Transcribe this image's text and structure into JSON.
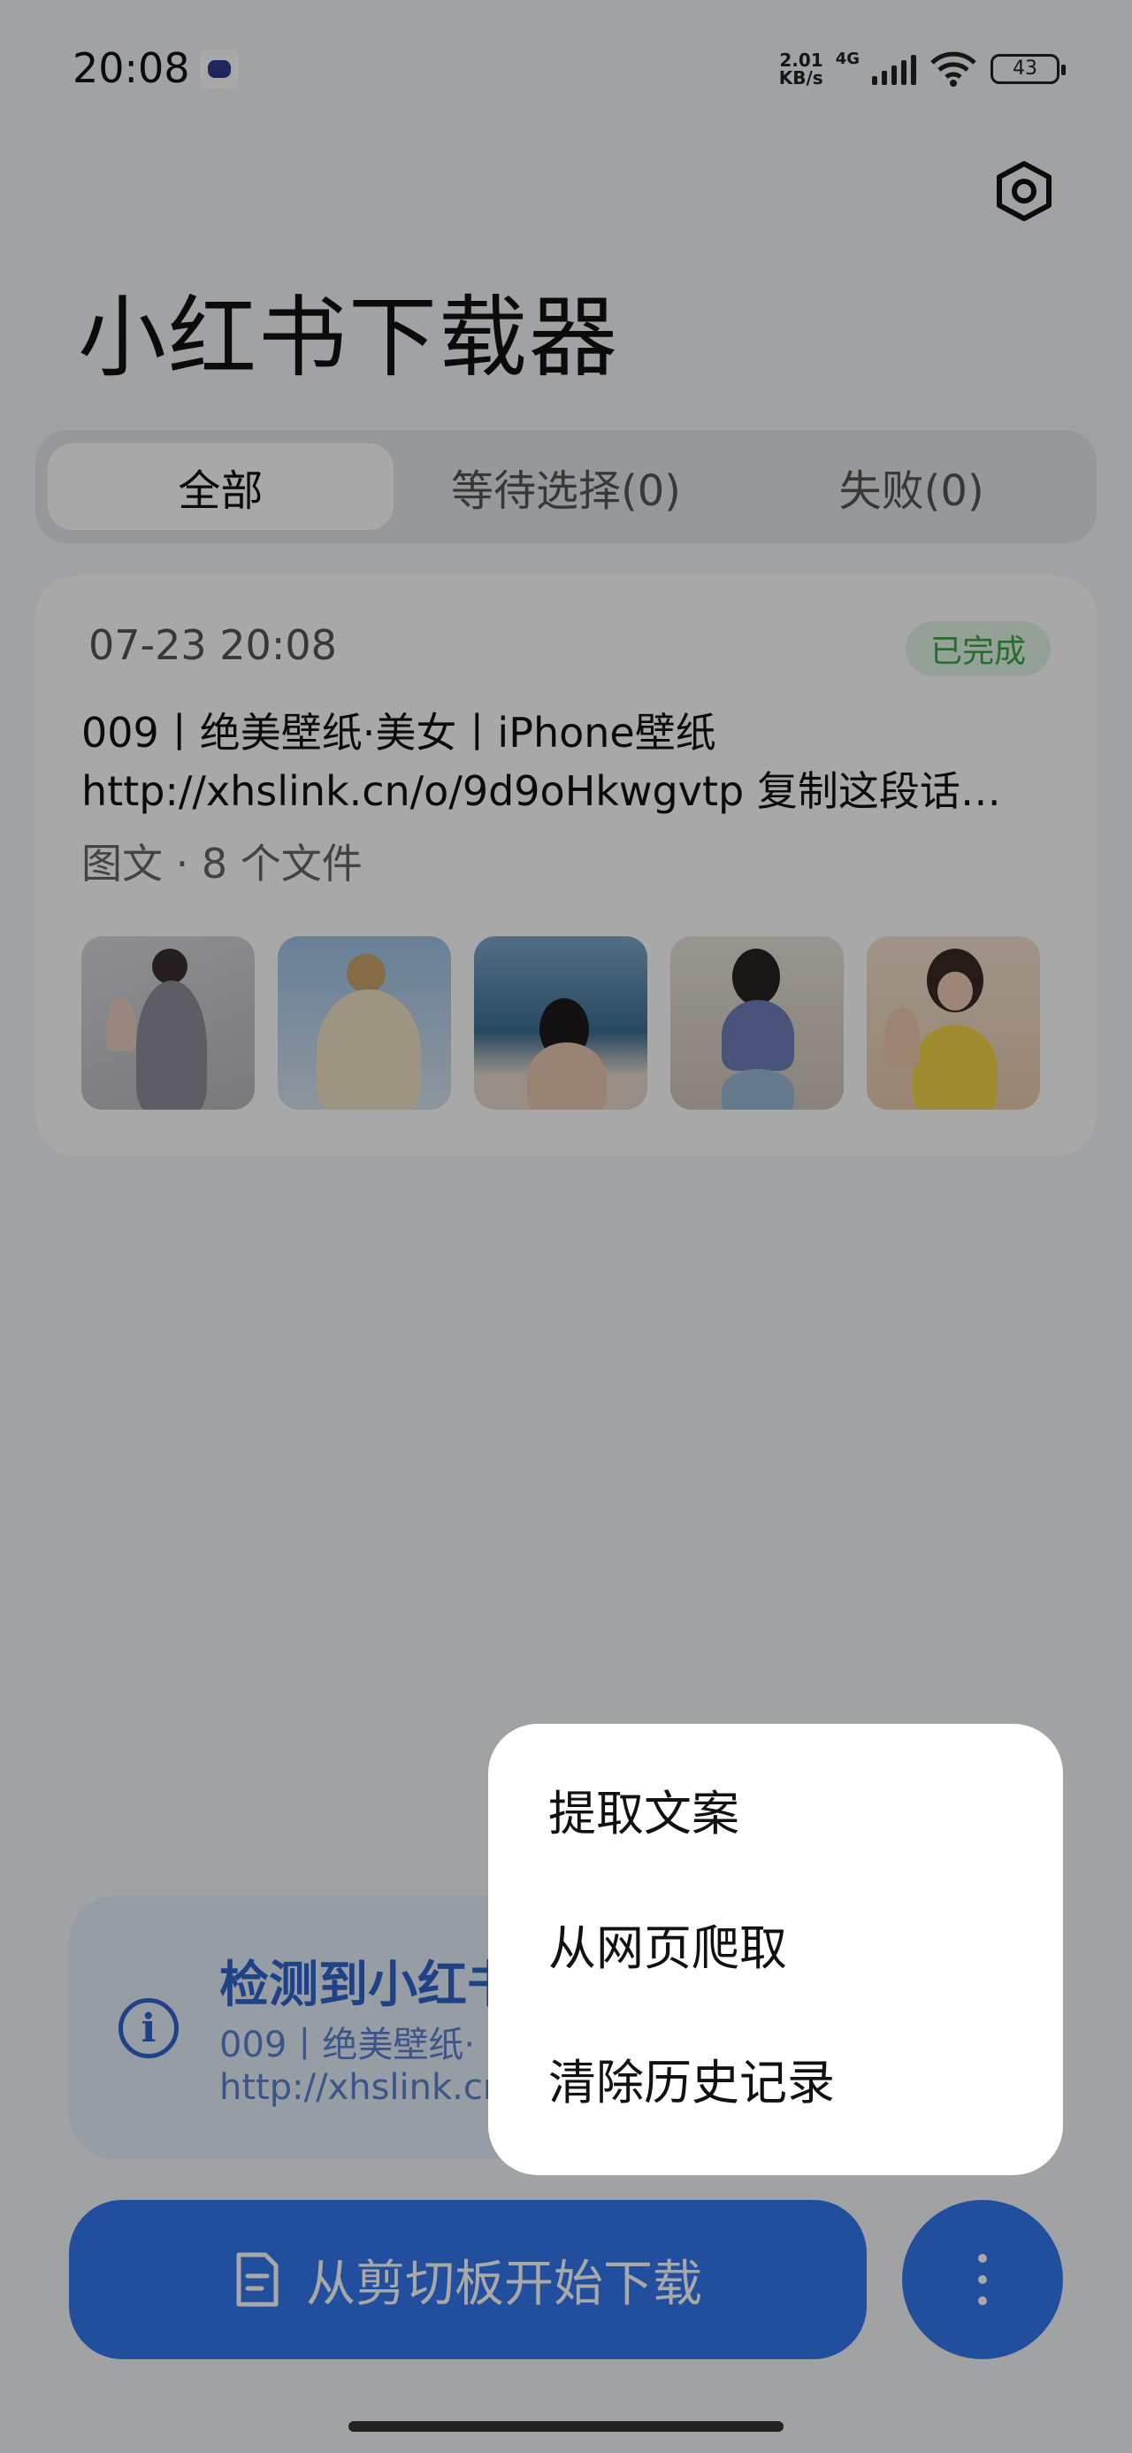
{
  "status_bar": {
    "time": "20:08",
    "net_speed_value": "2.01",
    "net_speed_unit": "KB/s",
    "network_type": "4G",
    "battery": "43"
  },
  "header": {
    "title": "小红书下载器",
    "settings_icon": "settings-hexagon-icon"
  },
  "tabs": [
    {
      "label": "全部",
      "active": true
    },
    {
      "label": "等待选择(0)",
      "active": false
    },
    {
      "label": "失败(0)",
      "active": false
    }
  ],
  "card": {
    "date": "07-23 20:08",
    "status": "已完成",
    "line1": "009丨绝美壁纸·美女丨iPhone壁纸",
    "line2": "http://xhslink.cn/o/9d9oHkwgvtp 复制这段话…",
    "meta": "图文 · 8 个文件",
    "thumbnail_count": 5
  },
  "banner": {
    "title": "检测到小红书",
    "subtitle1": "009丨绝美壁纸·",
    "subtitle2": "http://xhslink.cn"
  },
  "download_button": {
    "label": "从剪切板开始下载",
    "icon": "document-icon"
  },
  "more_button": {
    "icon": "more-vertical-icon"
  },
  "menu": {
    "items": [
      "提取文案",
      "从网页爬取",
      "清除历史记录"
    ]
  },
  "colors": {
    "accent": "#3277ee",
    "done_green": "#3aa447"
  }
}
